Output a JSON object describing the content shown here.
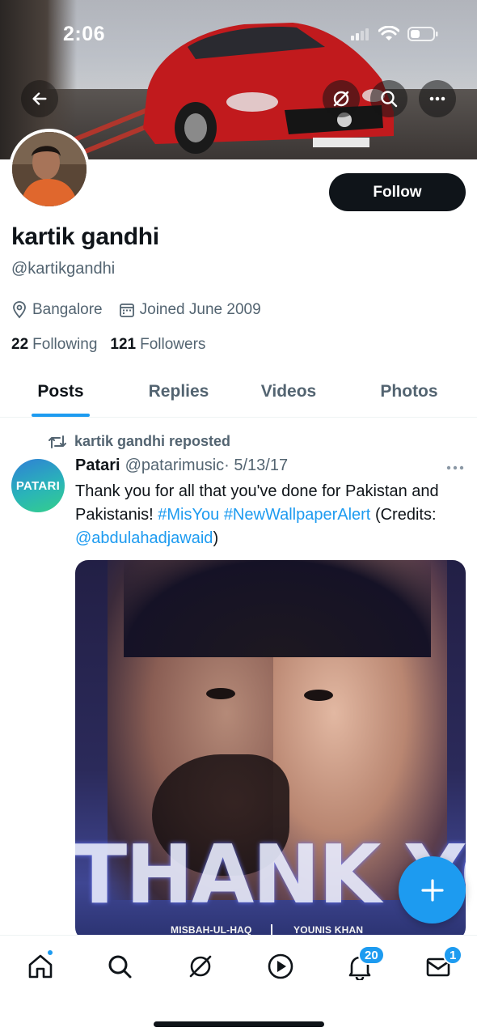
{
  "status_bar": {
    "time": "2:06"
  },
  "header": {
    "back_icon": "arrow-left-icon",
    "grok_icon": "grok-icon",
    "search_icon": "search-icon",
    "more_icon": "more-horizontal-icon"
  },
  "profile": {
    "name": "kartik gandhi",
    "handle": "@kartikgandhi",
    "follow_label": "Follow",
    "location": "Bangalore",
    "joined": "Joined June 2009",
    "following_count": "22",
    "following_label": "Following",
    "followers_count": "121",
    "followers_label": "Followers"
  },
  "tabs": [
    {
      "label": "Posts",
      "active": true
    },
    {
      "label": "Replies",
      "active": false
    },
    {
      "label": "Videos",
      "active": false
    },
    {
      "label": "Photos",
      "active": false
    }
  ],
  "post": {
    "repost_text": "kartik gandhi reposted",
    "author_name": "Patari",
    "author_handle": "@patarimusic",
    "date": "· 5/13/17",
    "avatar_text": "PATARI",
    "text_1": "Thank you for all that you've done for Pakistan and Pakistanis! ",
    "hashtag_1": "#MisYou",
    "hashtag_2": "#NewWallpaperAlert",
    "text_2": "(Credits: ",
    "mention": "@abdulahadjawaid",
    "text_3": ")",
    "media": {
      "headline": "THANK YOU",
      "caption_left": "MISBAH-UL-HAQ",
      "caption_right": "YOUNIS KHAN"
    }
  },
  "bottom_nav": {
    "notifications_badge": "20",
    "messages_badge": "1"
  },
  "colors": {
    "accent": "#1d9bf0",
    "text": "#0f1419",
    "secondary": "#536471"
  }
}
